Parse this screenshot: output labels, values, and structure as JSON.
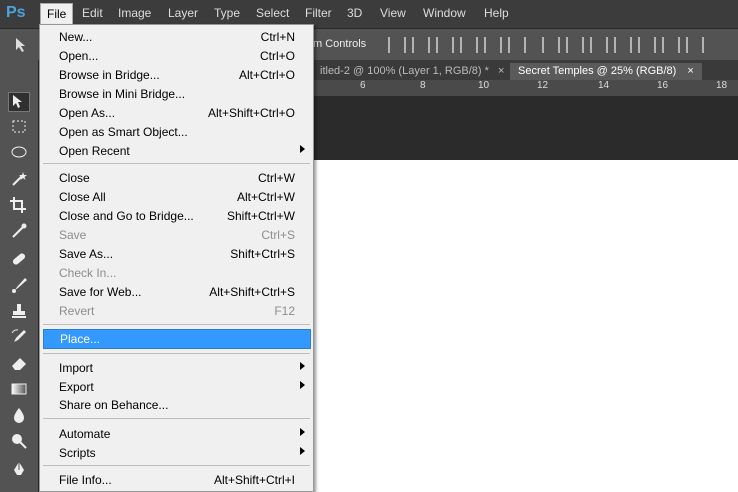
{
  "app": {
    "logo": "Ps"
  },
  "menubar": {
    "items": [
      "File",
      "Edit",
      "Image",
      "Layer",
      "Type",
      "Select",
      "Filter",
      "3D",
      "View",
      "Window",
      "Help"
    ]
  },
  "options": {
    "transform_label": "m Controls"
  },
  "tabs": [
    {
      "label": "itled-2 @ 100% (Layer 1, RGB/8) *",
      "close": "×"
    },
    {
      "label": "Secret Temples @ 25% (RGB/8)",
      "close": "×"
    }
  ],
  "ruler": {
    "ticks": [
      "6",
      "8",
      "10",
      "12",
      "14",
      "16",
      "18"
    ]
  },
  "file_menu": {
    "items": [
      {
        "label": "New...",
        "shortcut": "Ctrl+N"
      },
      {
        "label": "Open...",
        "shortcut": "Ctrl+O"
      },
      {
        "label": "Browse in Bridge...",
        "shortcut": "Alt+Ctrl+O"
      },
      {
        "label": "Browse in Mini Bridge...",
        "shortcut": ""
      },
      {
        "label": "Open As...",
        "shortcut": "Alt+Shift+Ctrl+O"
      },
      {
        "label": "Open as Smart Object...",
        "shortcut": ""
      },
      {
        "label": "Open Recent",
        "shortcut": ""
      },
      {
        "label": "Close",
        "shortcut": "Ctrl+W"
      },
      {
        "label": "Close All",
        "shortcut": "Alt+Ctrl+W"
      },
      {
        "label": "Close and Go to Bridge...",
        "shortcut": "Shift+Ctrl+W"
      },
      {
        "label": "Save",
        "shortcut": "Ctrl+S"
      },
      {
        "label": "Save As...",
        "shortcut": "Shift+Ctrl+S"
      },
      {
        "label": "Check In...",
        "shortcut": ""
      },
      {
        "label": "Save for Web...",
        "shortcut": "Alt+Shift+Ctrl+S"
      },
      {
        "label": "Revert",
        "shortcut": "F12"
      },
      {
        "label": "Place...",
        "shortcut": ""
      },
      {
        "label": "Import",
        "shortcut": ""
      },
      {
        "label": "Export",
        "shortcut": ""
      },
      {
        "label": "Share on Behance...",
        "shortcut": ""
      },
      {
        "label": "Automate",
        "shortcut": ""
      },
      {
        "label": "Scripts",
        "shortcut": ""
      },
      {
        "label": "File Info...",
        "shortcut": "Alt+Shift+Ctrl+I"
      }
    ]
  }
}
